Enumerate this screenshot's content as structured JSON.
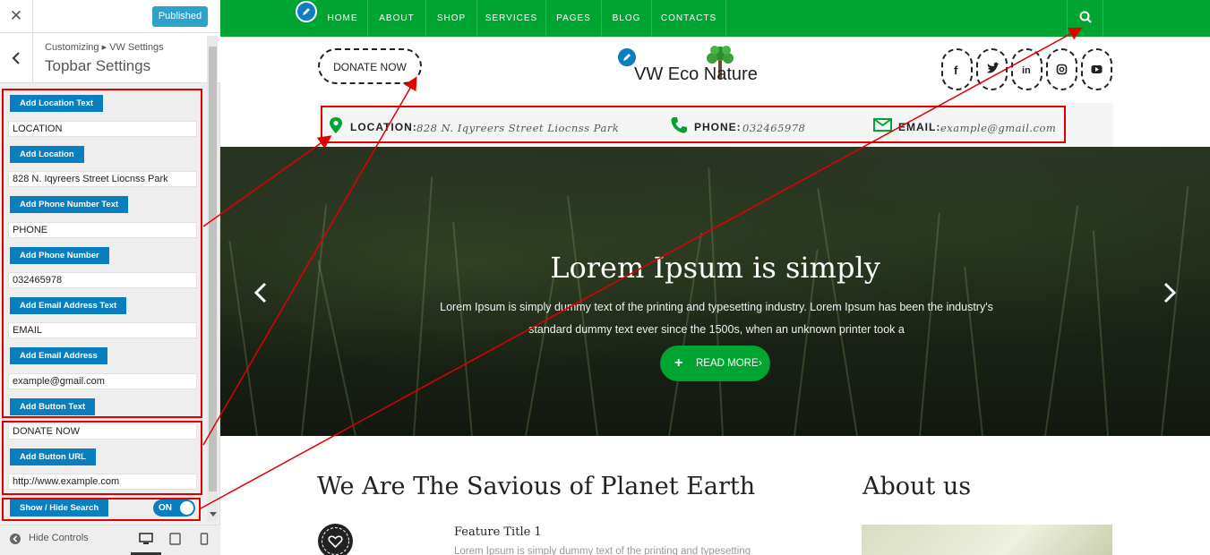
{
  "customizer": {
    "close_label": "✕",
    "published_label": "Published",
    "breadcrumb": "Customizing ▸ VW Settings",
    "section_title": "Topbar Settings",
    "rows": [
      {
        "button": "Add Location Text",
        "value": "LOCATION"
      },
      {
        "button": "Add Location",
        "value": "828 N. Iqyreers Street Liocnss Park"
      },
      {
        "button": "Add Phone Number Text",
        "value": "PHONE"
      },
      {
        "button": "Add Phone Number",
        "value": "032465978"
      },
      {
        "button": "Add Email Address Text",
        "value": "EMAIL"
      },
      {
        "button": "Add Email Address",
        "value": "example@gmail.com"
      },
      {
        "button": "Add Button Text",
        "value": "DONATE NOW"
      },
      {
        "button": "Add Button URL",
        "value": "http://www.example.com"
      }
    ],
    "search_toggle": {
      "label": "Show / Hide Search",
      "state": "ON"
    },
    "hide_controls": "Hide Controls"
  },
  "site": {
    "nav": [
      "HOME",
      "ABOUT",
      "SHOP",
      "SERVICES",
      "PAGES",
      "BLOG",
      "CONTACTS"
    ],
    "donate": "DONATE NOW",
    "logo": "VW Eco   Nature",
    "social_icons": [
      "facebook-icon",
      "twitter-icon",
      "linkedin-icon",
      "instagram-icon",
      "youtube-icon"
    ],
    "topbar": {
      "location_label": "LOCATION:",
      "location_value": "828 N. Iqyreers Street Liocnss Park",
      "phone_label": "PHONE:",
      "phone_value": "032465978",
      "email_label": "EMAIL:",
      "email_value": "example@gmail.com"
    },
    "hero": {
      "title": "Lorem Ipsum is simply",
      "text": "Lorem Ipsum is simply dummy text of the printing and typesetting industry. Lorem Ipsum has been the industry's standard dummy text ever since the 1500s, when an unknown printer took a",
      "button": "READ MORE"
    },
    "section_heading": "We Are The Savious of Planet Earth",
    "about_heading": "About us",
    "feature": {
      "title": "Feature Title 1",
      "text": "Lorem Ipsum is simply dummy text of the printing and typesetting"
    }
  },
  "colors": {
    "green": "#00a431",
    "panel_blue": "#0a7fc0",
    "annotation_red": "#e00000"
  }
}
